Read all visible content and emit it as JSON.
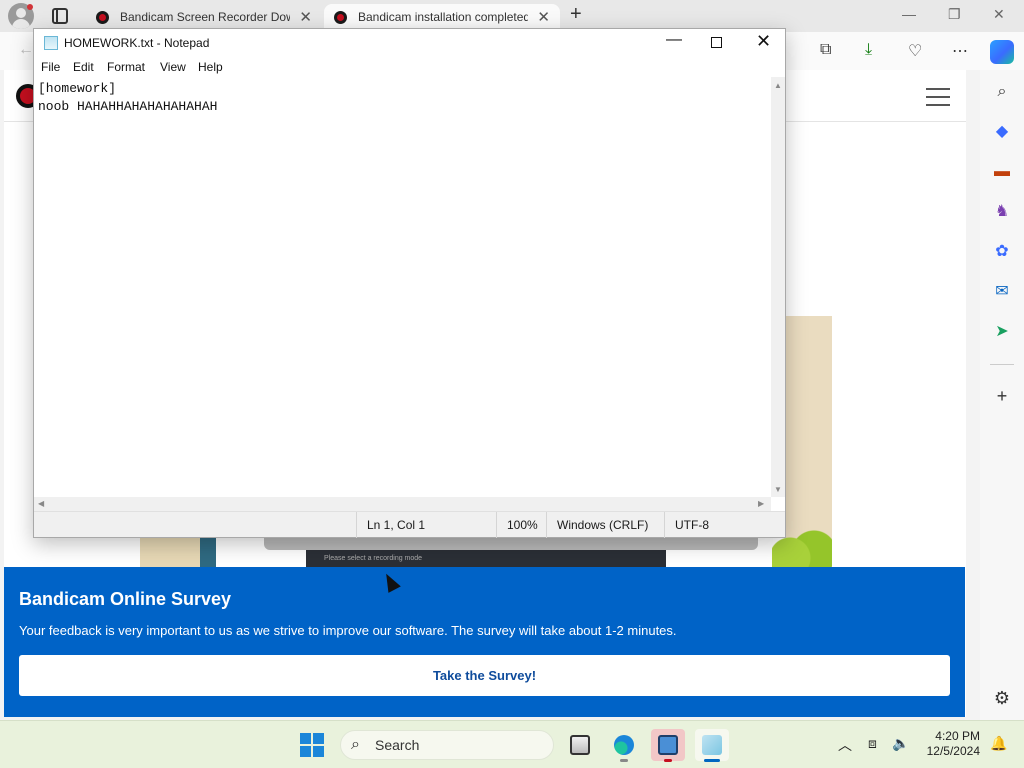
{
  "browser": {
    "tabs": [
      {
        "title": "Bandicam Screen Recorder Dow",
        "state": "inactive"
      },
      {
        "title": "Bandicam installation completed",
        "state": "active"
      }
    ],
    "new_tab": "+",
    "window_controls": {
      "minimize": "—",
      "restore": "❐",
      "close": "✕"
    },
    "toolbar_icons": [
      "collections-icon",
      "downloads-icon",
      "performance-icon",
      "more-icon",
      "copilot-icon"
    ],
    "sidebar_icons": [
      "search-icon",
      "shopping-icon",
      "tools-icon",
      "games-icon",
      "microsoft365-icon",
      "outlook-icon",
      "drop-icon",
      "add-icon",
      "settings-icon"
    ]
  },
  "survey": {
    "title": "Bandicam Online Survey",
    "text": "Your feedback is very important to us as we strive to improve our software. The survey will take about 1-2 minutes.",
    "button": "Take the Survey!"
  },
  "illustration": {
    "bar_text": "Please select a recording mode"
  },
  "notepad": {
    "title": "HOMEWORK.txt - Notepad",
    "menu": [
      "File",
      "Edit",
      "Format",
      "View",
      "Help"
    ],
    "content": "[homework]\nnoob HAHAHHAHAHAHAHAHAH",
    "status": {
      "position": "Ln 1, Col 1",
      "zoom": "100%",
      "line_endings": "Windows (CRLF)",
      "encoding": "UTF-8"
    }
  },
  "taskbar": {
    "search_placeholder": "Search",
    "apps": [
      "file-explorer-icon",
      "edge-icon",
      "bandicam-icon",
      "notepad-icon"
    ],
    "clock": {
      "time": "4:20 PM",
      "date": "12/5/2024"
    }
  }
}
